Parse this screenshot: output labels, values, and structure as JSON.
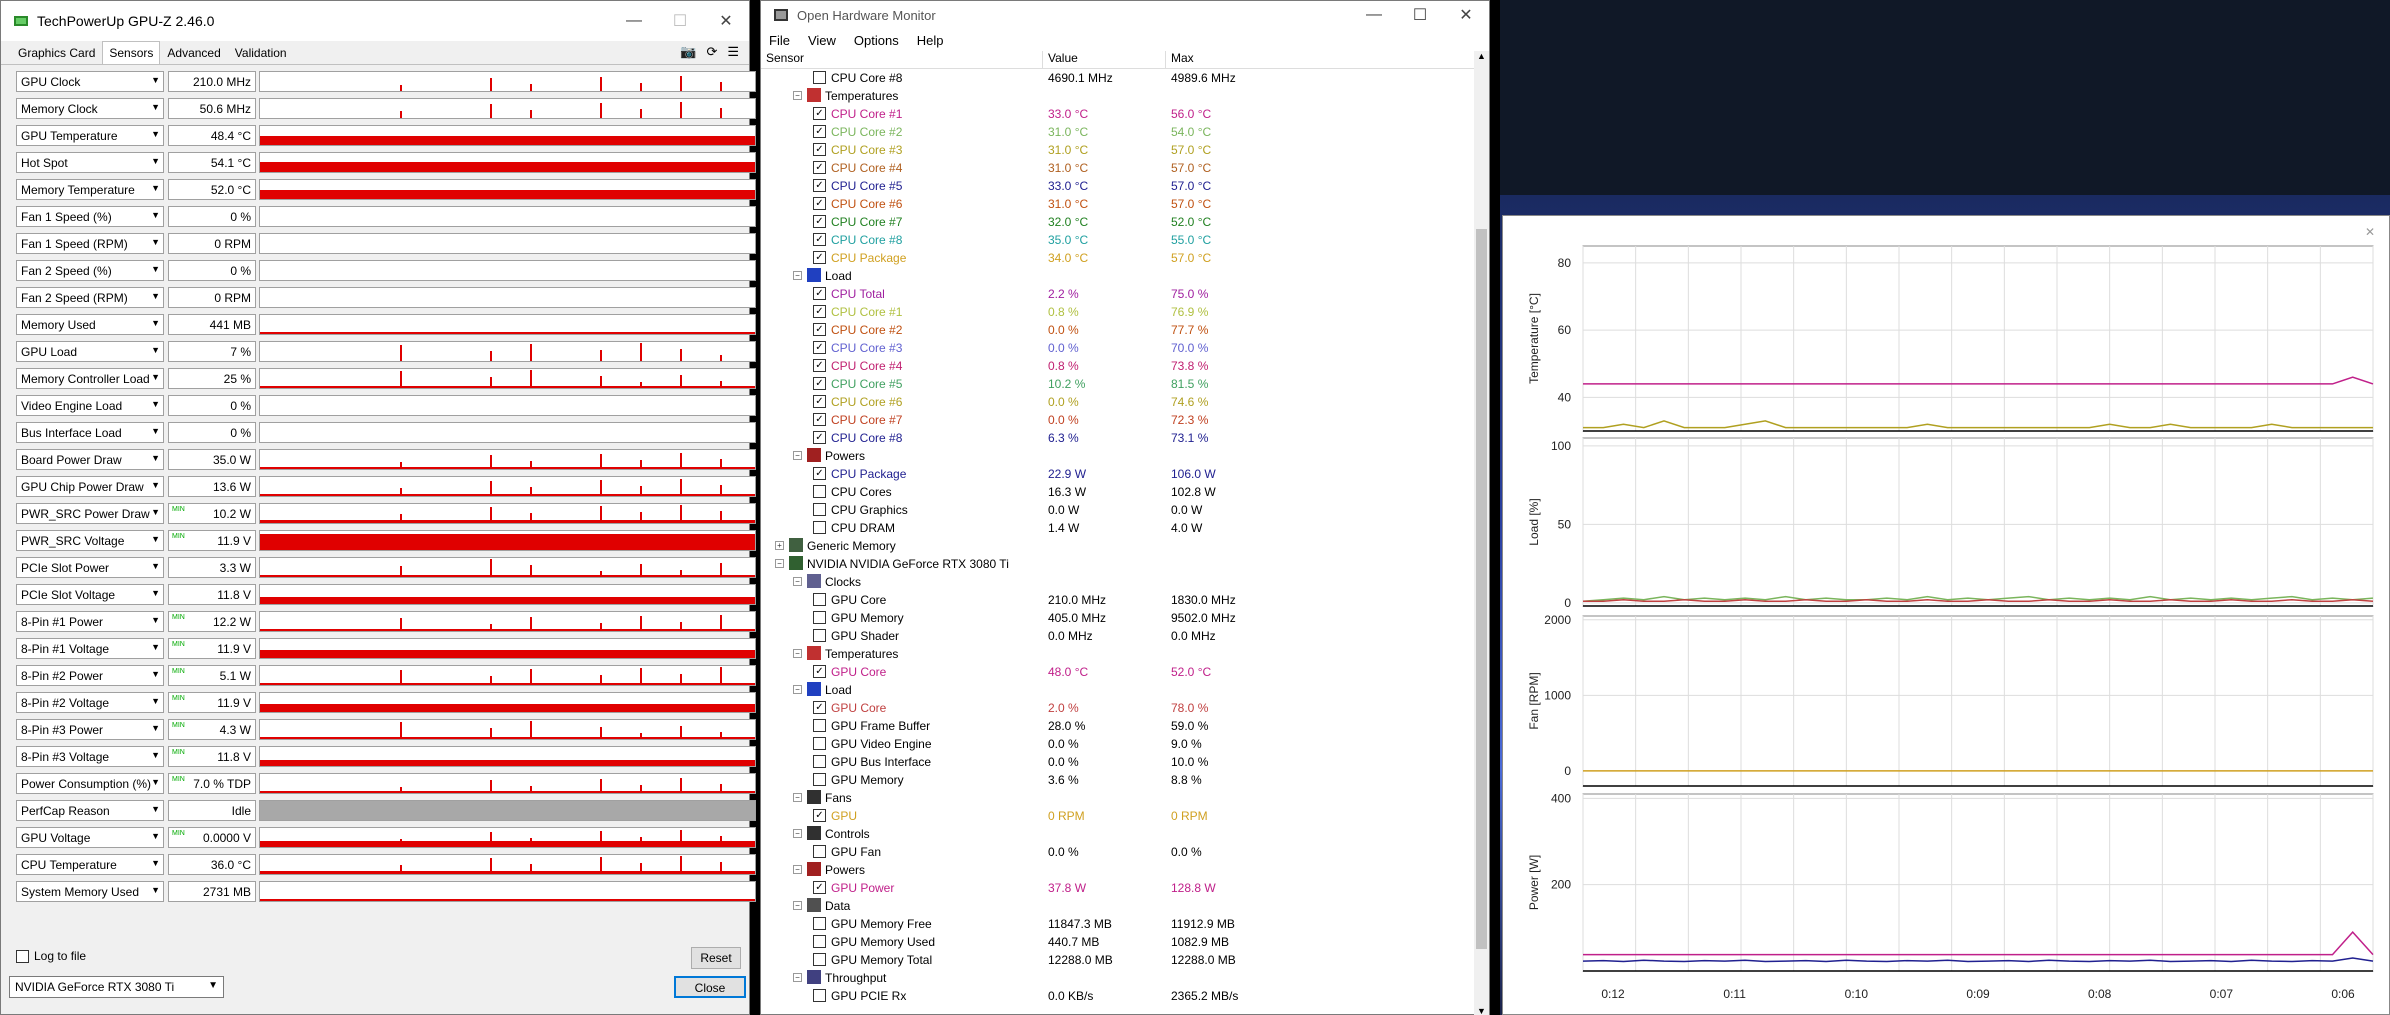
{
  "gpuz": {
    "title": "TechPowerUp GPU-Z 2.46.0",
    "tabs": [
      "Graphics Card",
      "Sensors",
      "Advanced",
      "Validation"
    ],
    "sensors": [
      {
        "label": "GPU Clock",
        "value": "210.0 MHz",
        "mm": "",
        "level": 0.0,
        "spikes": 1
      },
      {
        "label": "Memory Clock",
        "value": "50.6 MHz",
        "mm": "",
        "level": 0.0,
        "spikes": 1
      },
      {
        "label": "GPU Temperature",
        "value": "48.4 °C",
        "mm": "",
        "level": 0.45,
        "spikes": 0
      },
      {
        "label": "Hot Spot",
        "value": "54.1 °C",
        "mm": "",
        "level": 0.5,
        "spikes": 0
      },
      {
        "label": "Memory Temperature",
        "value": "52.0 °C",
        "mm": "",
        "level": 0.48,
        "spikes": 0
      },
      {
        "label": "Fan 1 Speed (%)",
        "value": "0 %",
        "mm": "",
        "level": 0.0,
        "spikes": 0
      },
      {
        "label": "Fan 1 Speed (RPM)",
        "value": "0 RPM",
        "mm": "",
        "level": 0.0,
        "spikes": 0
      },
      {
        "label": "Fan 2 Speed (%)",
        "value": "0 %",
        "mm": "",
        "level": 0.0,
        "spikes": 0
      },
      {
        "label": "Fan 2 Speed (RPM)",
        "value": "0 RPM",
        "mm": "",
        "level": 0.0,
        "spikes": 0
      },
      {
        "label": "Memory Used",
        "value": "441 MB",
        "mm": "",
        "level": 0.04,
        "spikes": 0
      },
      {
        "label": "GPU Load",
        "value": "7 %",
        "mm": "",
        "level": 0.0,
        "spikes": 1
      },
      {
        "label": "Memory Controller Load",
        "value": "25 %",
        "mm": "",
        "level": 0.1,
        "spikes": 1
      },
      {
        "label": "Video Engine Load",
        "value": "0 %",
        "mm": "",
        "level": 0.0,
        "spikes": 0
      },
      {
        "label": "Bus Interface Load",
        "value": "0 %",
        "mm": "",
        "level": 0.0,
        "spikes": 0
      },
      {
        "label": "Board Power Draw",
        "value": "35.0 W",
        "mm": "",
        "level": 0.12,
        "spikes": 1
      },
      {
        "label": "GPU Chip Power Draw",
        "value": "13.6 W",
        "mm": "",
        "level": 0.12,
        "spikes": 1
      },
      {
        "label": "PWR_SRC Power Draw",
        "value": "10.2 W",
        "mm": "MIN",
        "level": 0.15,
        "spikes": 1
      },
      {
        "label": "PWR_SRC Voltage",
        "value": "11.9 V",
        "mm": "MIN",
        "level": 0.85,
        "spikes": 0
      },
      {
        "label": "PCIe Slot Power",
        "value": "3.3 W",
        "mm": "",
        "level": 0.1,
        "spikes": 1
      },
      {
        "label": "PCIe Slot Voltage",
        "value": "11.8 V",
        "mm": "",
        "level": 0.35,
        "spikes": 0
      },
      {
        "label": "8-Pin #1 Power",
        "value": "12.2 W",
        "mm": "MIN",
        "level": 0.12,
        "spikes": 1
      },
      {
        "label": "8-Pin #1 Voltage",
        "value": "11.9 V",
        "mm": "MIN",
        "level": 0.4,
        "spikes": 0
      },
      {
        "label": "8-Pin #2 Power",
        "value": "5.1 W",
        "mm": "MIN",
        "level": 0.1,
        "spikes": 1
      },
      {
        "label": "8-Pin #2 Voltage",
        "value": "11.9 V",
        "mm": "MIN",
        "level": 0.4,
        "spikes": 0
      },
      {
        "label": "8-Pin #3 Power",
        "value": "4.3 W",
        "mm": "MIN",
        "level": 0.1,
        "spikes": 1
      },
      {
        "label": "8-Pin #3 Voltage",
        "value": "11.8 V",
        "mm": "MIN",
        "level": 0.3,
        "spikes": 0
      },
      {
        "label": "Power Consumption (%)",
        "value": "7.0 % TDP",
        "mm": "MIN",
        "level": 0.1,
        "spikes": 1
      },
      {
        "label": "PerfCap Reason",
        "value": "Idle",
        "mm": "",
        "level": -1,
        "spikes": 0
      },
      {
        "label": "GPU Voltage",
        "value": "0.0000 V",
        "mm": "MIN",
        "level": 0.3,
        "spikes": 1
      },
      {
        "label": "CPU Temperature",
        "value": "36.0 °C",
        "mm": "",
        "level": 0.15,
        "spikes": 1
      },
      {
        "label": "System Memory Used",
        "value": "2731 MB",
        "mm": "",
        "level": 0.1,
        "spikes": 0
      }
    ],
    "log_label": "Log to file",
    "reset_label": "Reset",
    "device": "NVIDIA GeForce RTX 3080 Ti",
    "close_label": "Close"
  },
  "ohm": {
    "title": "Open Hardware Monitor",
    "menu": [
      "File",
      "View",
      "Options",
      "Help"
    ],
    "columns": [
      "Sensor",
      "Value",
      "Max"
    ],
    "rows": [
      {
        "lvl": 3,
        "type": "s",
        "chk": false,
        "name": "CPU Core #8",
        "value": "4690.1 MHz",
        "max": "4989.6 MHz",
        "color": "#000000"
      },
      {
        "lvl": 2,
        "type": "g",
        "exp": "−",
        "icon": "thermometer-icon",
        "name": "Temperatures"
      },
      {
        "lvl": 3,
        "type": "s",
        "chk": true,
        "name": "CPU Core #1",
        "value": "33.0 °C",
        "max": "56.0 °C",
        "color": "#c0208a"
      },
      {
        "lvl": 3,
        "type": "s",
        "chk": true,
        "name": "CPU Core #2",
        "value": "31.0 °C",
        "max": "54.0 °C",
        "color": "#7ab55c"
      },
      {
        "lvl": 3,
        "type": "s",
        "chk": true,
        "name": "CPU Core #3",
        "value": "31.0 °C",
        "max": "57.0 °C",
        "color": "#b0a020"
      },
      {
        "lvl": 3,
        "type": "s",
        "chk": true,
        "name": "CPU Core #4",
        "value": "31.0 °C",
        "max": "57.0 °C",
        "color": "#b06020"
      },
      {
        "lvl": 3,
        "type": "s",
        "chk": true,
        "name": "CPU Core #5",
        "value": "33.0 °C",
        "max": "57.0 °C",
        "color": "#202090"
      },
      {
        "lvl": 3,
        "type": "s",
        "chk": true,
        "name": "CPU Core #6",
        "value": "31.0 °C",
        "max": "57.0 °C",
        "color": "#c05010"
      },
      {
        "lvl": 3,
        "type": "s",
        "chk": true,
        "name": "CPU Core #7",
        "value": "32.0 °C",
        "max": "52.0 °C",
        "color": "#208020"
      },
      {
        "lvl": 3,
        "type": "s",
        "chk": true,
        "name": "CPU Core #8",
        "value": "35.0 °C",
        "max": "55.0 °C",
        "color": "#20a0a0"
      },
      {
        "lvl": 3,
        "type": "s",
        "chk": true,
        "name": "CPU Package",
        "value": "34.0 °C",
        "max": "57.0 °C",
        "color": "#d0a020"
      },
      {
        "lvl": 2,
        "type": "g",
        "exp": "−",
        "icon": "load-icon",
        "name": "Load"
      },
      {
        "lvl": 3,
        "type": "s",
        "chk": true,
        "name": "CPU Total",
        "value": "2.2 %",
        "max": "75.0 %",
        "color": "#a020a0"
      },
      {
        "lvl": 3,
        "type": "s",
        "chk": true,
        "name": "CPU Core #1",
        "value": "0.8 %",
        "max": "76.9 %",
        "color": "#b0c040"
      },
      {
        "lvl": 3,
        "type": "s",
        "chk": true,
        "name": "CPU Core #2",
        "value": "0.0 %",
        "max": "77.7 %",
        "color": "#c05010"
      },
      {
        "lvl": 3,
        "type": "s",
        "chk": true,
        "name": "CPU Core #3",
        "value": "0.0 %",
        "max": "70.0 %",
        "color": "#6060d0"
      },
      {
        "lvl": 3,
        "type": "s",
        "chk": true,
        "name": "CPU Core #4",
        "value": "0.8 %",
        "max": "73.8 %",
        "color": "#c02070"
      },
      {
        "lvl": 3,
        "type": "s",
        "chk": true,
        "name": "CPU Core #5",
        "value": "10.2 %",
        "max": "81.5 %",
        "color": "#40a060"
      },
      {
        "lvl": 3,
        "type": "s",
        "chk": true,
        "name": "CPU Core #6",
        "value": "0.0 %",
        "max": "74.6 %",
        "color": "#b0a020"
      },
      {
        "lvl": 3,
        "type": "s",
        "chk": true,
        "name": "CPU Core #7",
        "value": "0.0 %",
        "max": "72.3 %",
        "color": "#c04020"
      },
      {
        "lvl": 3,
        "type": "s",
        "chk": true,
        "name": "CPU Core #8",
        "value": "6.3 %",
        "max": "73.1 %",
        "color": "#202090"
      },
      {
        "lvl": 2,
        "type": "g",
        "exp": "−",
        "icon": "power-icon",
        "name": "Powers"
      },
      {
        "lvl": 3,
        "type": "s",
        "chk": true,
        "name": "CPU Package",
        "value": "22.9 W",
        "max": "106.0 W",
        "color": "#202090"
      },
      {
        "lvl": 3,
        "type": "s",
        "chk": false,
        "name": "CPU Cores",
        "value": "16.3 W",
        "max": "102.8 W",
        "color": "#000000"
      },
      {
        "lvl": 3,
        "type": "s",
        "chk": false,
        "name": "CPU Graphics",
        "value": "0.0 W",
        "max": "0.0 W",
        "color": "#000000"
      },
      {
        "lvl": 3,
        "type": "s",
        "chk": false,
        "name": "CPU DRAM",
        "value": "1.4 W",
        "max": "4.0 W",
        "color": "#000000"
      },
      {
        "lvl": 1,
        "type": "g",
        "exp": "+",
        "icon": "memory-icon",
        "name": "Generic Memory"
      },
      {
        "lvl": 1,
        "type": "g",
        "exp": "−",
        "icon": "gpu-icon",
        "name": "NVIDIA NVIDIA GeForce RTX 3080 Ti"
      },
      {
        "lvl": 2,
        "type": "g",
        "exp": "−",
        "icon": "clock-icon",
        "name": "Clocks"
      },
      {
        "lvl": 3,
        "type": "s",
        "chk": false,
        "name": "GPU Core",
        "value": "210.0 MHz",
        "max": "1830.0 MHz",
        "color": "#000000"
      },
      {
        "lvl": 3,
        "type": "s",
        "chk": false,
        "name": "GPU Memory",
        "value": "405.0 MHz",
        "max": "9502.0 MHz",
        "color": "#000000"
      },
      {
        "lvl": 3,
        "type": "s",
        "chk": false,
        "name": "GPU Shader",
        "value": "0.0 MHz",
        "max": "0.0 MHz",
        "color": "#000000"
      },
      {
        "lvl": 2,
        "type": "g",
        "exp": "−",
        "icon": "thermometer-icon",
        "name": "Temperatures"
      },
      {
        "lvl": 3,
        "type": "s",
        "chk": true,
        "name": "GPU Core",
        "value": "48.0 °C",
        "max": "52.0 °C",
        "color": "#c0208a"
      },
      {
        "lvl": 2,
        "type": "g",
        "exp": "−",
        "icon": "load-icon",
        "name": "Load"
      },
      {
        "lvl": 3,
        "type": "s",
        "chk": true,
        "name": "GPU Core",
        "value": "2.0 %",
        "max": "78.0 %",
        "color": "#c04040"
      },
      {
        "lvl": 3,
        "type": "s",
        "chk": false,
        "name": "GPU Frame Buffer",
        "value": "28.0 %",
        "max": "59.0 %",
        "color": "#000000"
      },
      {
        "lvl": 3,
        "type": "s",
        "chk": false,
        "name": "GPU Video Engine",
        "value": "0.0 %",
        "max": "9.0 %",
        "color": "#000000"
      },
      {
        "lvl": 3,
        "type": "s",
        "chk": false,
        "name": "GPU Bus Interface",
        "value": "0.0 %",
        "max": "10.0 %",
        "color": "#000000"
      },
      {
        "lvl": 3,
        "type": "s",
        "chk": false,
        "name": "GPU Memory",
        "value": "3.6 %",
        "max": "8.8 %",
        "color": "#000000"
      },
      {
        "lvl": 2,
        "type": "g",
        "exp": "−",
        "icon": "fan-icon",
        "name": "Fans"
      },
      {
        "lvl": 3,
        "type": "s",
        "chk": true,
        "name": "GPU",
        "value": "0 RPM",
        "max": "0 RPM",
        "color": "#d0a020"
      },
      {
        "lvl": 2,
        "type": "g",
        "exp": "−",
        "icon": "controls-icon",
        "name": "Controls"
      },
      {
        "lvl": 3,
        "type": "s",
        "chk": false,
        "name": "GPU Fan",
        "value": "0.0 %",
        "max": "0.0 %",
        "color": "#000000"
      },
      {
        "lvl": 2,
        "type": "g",
        "exp": "−",
        "icon": "power-icon",
        "name": "Powers"
      },
      {
        "lvl": 3,
        "type": "s",
        "chk": true,
        "name": "GPU Power",
        "value": "37.8 W",
        "max": "128.8 W",
        "color": "#c0208a"
      },
      {
        "lvl": 2,
        "type": "g",
        "exp": "−",
        "icon": "data-icon",
        "name": "Data"
      },
      {
        "lvl": 3,
        "type": "s",
        "chk": false,
        "name": "GPU Memory Free",
        "value": "11847.3 MB",
        "max": "11912.9 MB",
        "color": "#000000"
      },
      {
        "lvl": 3,
        "type": "s",
        "chk": false,
        "name": "GPU Memory Used",
        "value": "440.7 MB",
        "max": "1082.9 MB",
        "color": "#000000"
      },
      {
        "lvl": 3,
        "type": "s",
        "chk": false,
        "name": "GPU Memory Total",
        "value": "12288.0 MB",
        "max": "12288.0 MB",
        "color": "#000000"
      },
      {
        "lvl": 2,
        "type": "g",
        "exp": "−",
        "icon": "throughput-icon",
        "name": "Throughput"
      },
      {
        "lvl": 3,
        "type": "s",
        "chk": false,
        "name": "GPU PCIE Rx",
        "value": "0.0 KB/s",
        "max": "2365.2 MB/s",
        "color": "#000000"
      }
    ]
  },
  "chart_data": [
    {
      "type": "line",
      "ylabel": "Temperature [°C]",
      "yticks": [
        40,
        60,
        80
      ],
      "ylim": [
        30,
        85
      ],
      "series": [
        {
          "color": "#c0208a",
          "values": [
            44,
            44,
            44,
            44,
            44,
            44,
            44,
            44,
            44,
            44,
            44,
            44,
            44,
            44,
            44,
            44,
            44,
            44,
            44,
            44,
            44,
            44,
            44,
            44,
            44,
            44,
            44,
            44,
            44,
            44,
            44,
            44,
            44,
            44,
            44,
            44,
            44,
            44,
            46,
            44
          ]
        },
        {
          "color": "#b0a020",
          "values": [
            31,
            31,
            32,
            31,
            33,
            31,
            31,
            31,
            32,
            33,
            31,
            31,
            31,
            31,
            31,
            31,
            31,
            32,
            31,
            31,
            31,
            31,
            31,
            31,
            31,
            31,
            32,
            31,
            31,
            32,
            31,
            31,
            31,
            31,
            32,
            31,
            31,
            31,
            31,
            31
          ]
        }
      ]
    },
    {
      "type": "line",
      "ylabel": "Load [%]",
      "yticks": [
        0,
        50,
        100
      ],
      "ylim": [
        -2,
        105
      ],
      "series": [
        {
          "color": "#7ab55c",
          "values": [
            1,
            2,
            3,
            2,
            4,
            2,
            3,
            2,
            3,
            2,
            4,
            2,
            3,
            2,
            2,
            3,
            2,
            4,
            2,
            3,
            2,
            3,
            4,
            2,
            3,
            2,
            3,
            2,
            4,
            2,
            3,
            2,
            3,
            2,
            3,
            4,
            2,
            3,
            2,
            3
          ]
        },
        {
          "color": "#c04040",
          "values": [
            1,
            1,
            2,
            1,
            1,
            2,
            1,
            1,
            2,
            1,
            1,
            2,
            1,
            1,
            2,
            1,
            1,
            2,
            1,
            1,
            2,
            1,
            1,
            2,
            1,
            1,
            2,
            1,
            1,
            2,
            1,
            1,
            2,
            1,
            1,
            2,
            1,
            1,
            2,
            1
          ]
        }
      ]
    },
    {
      "type": "line",
      "ylabel": "Fan [RPM]",
      "yticks": [
        0,
        1000,
        2000
      ],
      "ylim": [
        -200,
        2050
      ],
      "series": [
        {
          "color": "#d0a020",
          "values": [
            0,
            0,
            0,
            0,
            0,
            0,
            0,
            0,
            0,
            0,
            0,
            0,
            0,
            0,
            0,
            0,
            0,
            0,
            0,
            0,
            0,
            0,
            0,
            0,
            0,
            0,
            0,
            0,
            0,
            0,
            0,
            0,
            0,
            0,
            0,
            0,
            0,
            0,
            0,
            0
          ]
        }
      ]
    },
    {
      "type": "line",
      "ylabel": "Power [W]",
      "yticks": [
        200,
        400
      ],
      "ylim": [
        0,
        410
      ],
      "series": [
        {
          "color": "#c0208a",
          "values": [
            38,
            38,
            38,
            38,
            38,
            38,
            38,
            38,
            38,
            38,
            38,
            38,
            38,
            38,
            38,
            38,
            38,
            38,
            38,
            38,
            38,
            38,
            38,
            38,
            38,
            38,
            38,
            38,
            38,
            38,
            38,
            38,
            38,
            38,
            38,
            38,
            38,
            38,
            90,
            38
          ]
        },
        {
          "color": "#202090",
          "values": [
            23,
            24,
            22,
            25,
            23,
            22,
            24,
            23,
            25,
            22,
            23,
            24,
            22,
            25,
            23,
            22,
            24,
            23,
            25,
            22,
            23,
            24,
            22,
            25,
            23,
            22,
            24,
            23,
            25,
            22,
            23,
            24,
            22,
            25,
            23,
            22,
            24,
            23,
            30,
            23
          ]
        }
      ]
    }
  ],
  "plot_xticks": [
    "0:12",
    "0:11",
    "0:10",
    "0:09",
    "0:08",
    "0:07",
    "0:06"
  ]
}
